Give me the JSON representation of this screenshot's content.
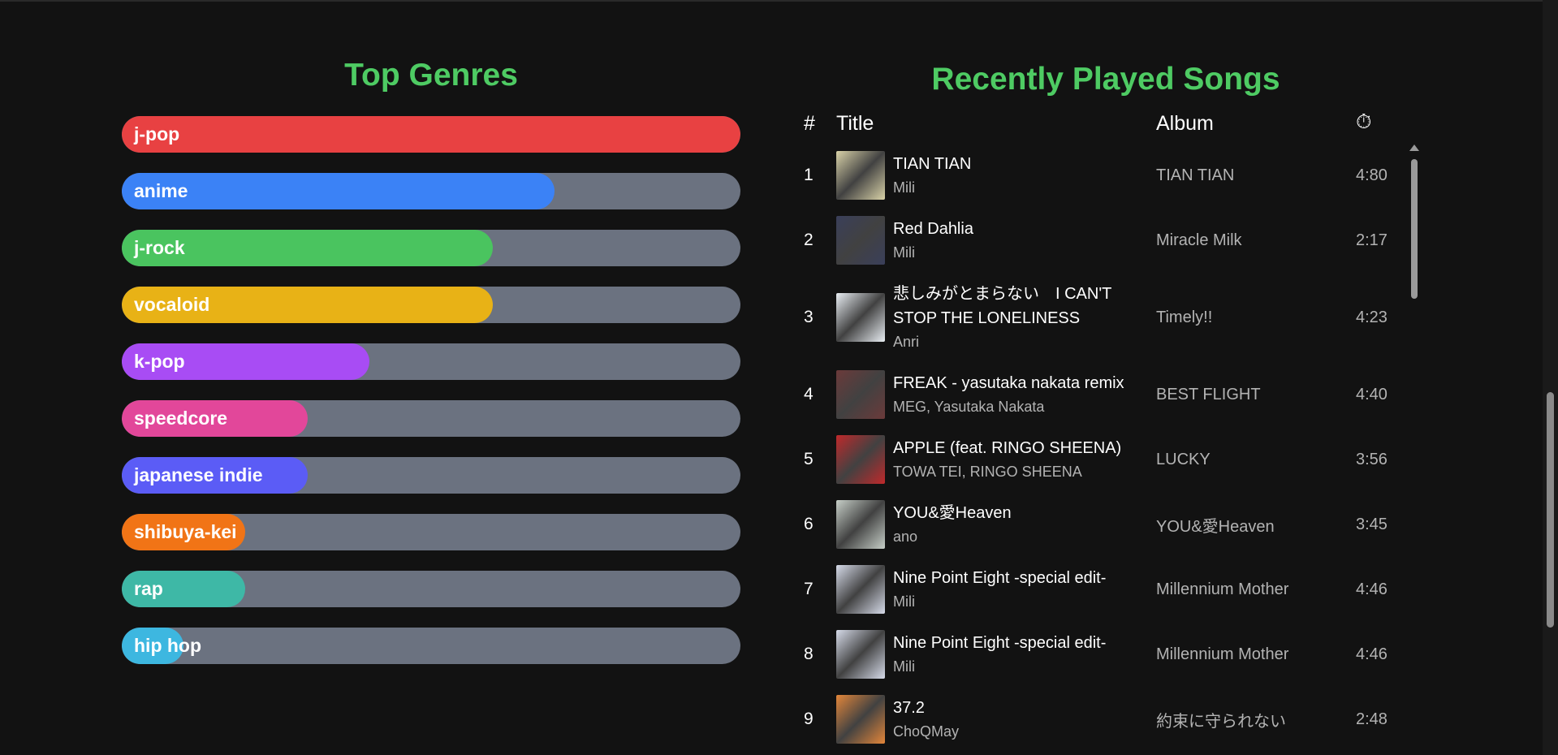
{
  "genres": {
    "title": "Top Genres",
    "items": [
      {
        "label": "j-pop",
        "level": 1.0,
        "color": "#e84142"
      },
      {
        "label": "anime",
        "level": 0.7,
        "color": "#3b82f6"
      },
      {
        "label": "j-rock",
        "level": 0.6,
        "color": "#4ac45f"
      },
      {
        "label": "vocaloid",
        "level": 0.6,
        "color": "#e8b216"
      },
      {
        "label": "k-pop",
        "level": 0.4,
        "color": "#a84cf4"
      },
      {
        "label": "speedcore",
        "level": 0.3,
        "color": "#e2479a"
      },
      {
        "label": "japanese indie",
        "level": 0.3,
        "color": "#5b5cf6"
      },
      {
        "label": "shibuya-kei",
        "level": 0.2,
        "color": "#f17416"
      },
      {
        "label": "rap",
        "level": 0.2,
        "color": "#3eb8a6"
      },
      {
        "label": "hip hop",
        "level": 0.1,
        "color": "#3db7e0"
      }
    ]
  },
  "songs": {
    "title": "Recently Played Songs",
    "headers": {
      "num": "#",
      "title": "Title",
      "album": "Album",
      "time_icon": "timer-icon",
      "time_glyph": "⏱"
    },
    "items": [
      {
        "num": "1",
        "title": "TIAN TIAN",
        "artist": "Mili",
        "album": "TIAN TIAN",
        "duration": "4:80",
        "cover": "#d9d2a8"
      },
      {
        "num": "2",
        "title": "Red Dahlia",
        "artist": "Mili",
        "album": "Miracle Milk",
        "duration": "2:17",
        "cover": "#3a3f5a"
      },
      {
        "num": "3",
        "title": "悲しみがとまらない　I CAN'T STOP THE LONELINESS",
        "artist": "Anri",
        "album": "Timely!!",
        "duration": "4:23",
        "cover": "#e9eef3"
      },
      {
        "num": "4",
        "title": "FREAK - yasutaka nakata remix",
        "artist": "MEG, Yasutaka Nakata",
        "album": "BEST FLIGHT",
        "duration": "4:40",
        "cover": "#6b3a3a"
      },
      {
        "num": "5",
        "title": "APPLE (feat. RINGO SHEENA)",
        "artist": "TOWA TEI, RINGO SHEENA",
        "album": "LUCKY",
        "duration": "3:56",
        "cover": "#c0292b"
      },
      {
        "num": "6",
        "title": "YOU&愛Heaven",
        "artist": "ano",
        "album": "YOU&愛Heaven",
        "duration": "3:45",
        "cover": "#c7cfc8"
      },
      {
        "num": "7",
        "title": "Nine Point Eight -special edit-",
        "artist": "Mili",
        "album": "Millennium Mother",
        "duration": "4:46",
        "cover": "#d6dbe9"
      },
      {
        "num": "8",
        "title": "Nine Point Eight -special edit-",
        "artist": "Mili",
        "album": "Millennium Mother",
        "duration": "4:46",
        "cover": "#d6dbe9"
      },
      {
        "num": "9",
        "title": "37.2",
        "artist": "ChoQMay",
        "album": "約束に守られない",
        "duration": "2:48",
        "cover": "#e3863a"
      }
    ]
  }
}
